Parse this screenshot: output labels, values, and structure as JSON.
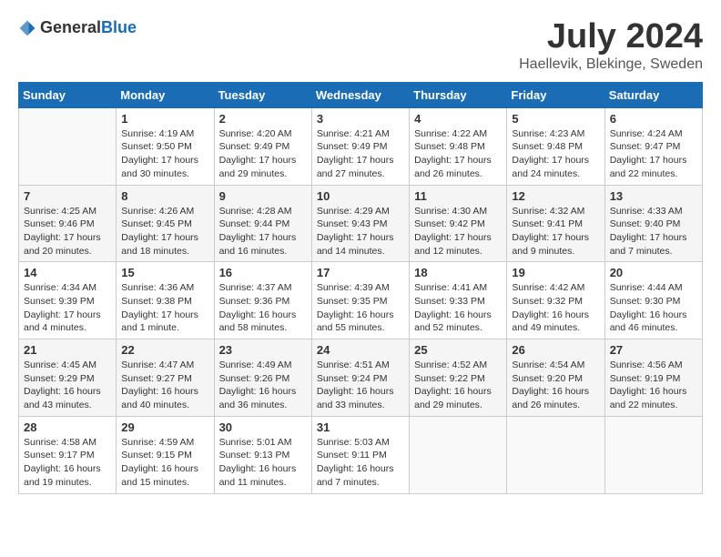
{
  "header": {
    "logo_general": "General",
    "logo_blue": "Blue",
    "title": "July 2024",
    "subtitle": "Haellevik, Blekinge, Sweden"
  },
  "calendar": {
    "days_of_week": [
      "Sunday",
      "Monday",
      "Tuesday",
      "Wednesday",
      "Thursday",
      "Friday",
      "Saturday"
    ],
    "weeks": [
      [
        {
          "day": "",
          "info": ""
        },
        {
          "day": "1",
          "info": "Sunrise: 4:19 AM\nSunset: 9:50 PM\nDaylight: 17 hours\nand 30 minutes."
        },
        {
          "day": "2",
          "info": "Sunrise: 4:20 AM\nSunset: 9:49 PM\nDaylight: 17 hours\nand 29 minutes."
        },
        {
          "day": "3",
          "info": "Sunrise: 4:21 AM\nSunset: 9:49 PM\nDaylight: 17 hours\nand 27 minutes."
        },
        {
          "day": "4",
          "info": "Sunrise: 4:22 AM\nSunset: 9:48 PM\nDaylight: 17 hours\nand 26 minutes."
        },
        {
          "day": "5",
          "info": "Sunrise: 4:23 AM\nSunset: 9:48 PM\nDaylight: 17 hours\nand 24 minutes."
        },
        {
          "day": "6",
          "info": "Sunrise: 4:24 AM\nSunset: 9:47 PM\nDaylight: 17 hours\nand 22 minutes."
        }
      ],
      [
        {
          "day": "7",
          "info": "Sunrise: 4:25 AM\nSunset: 9:46 PM\nDaylight: 17 hours\nand 20 minutes."
        },
        {
          "day": "8",
          "info": "Sunrise: 4:26 AM\nSunset: 9:45 PM\nDaylight: 17 hours\nand 18 minutes."
        },
        {
          "day": "9",
          "info": "Sunrise: 4:28 AM\nSunset: 9:44 PM\nDaylight: 17 hours\nand 16 minutes."
        },
        {
          "day": "10",
          "info": "Sunrise: 4:29 AM\nSunset: 9:43 PM\nDaylight: 17 hours\nand 14 minutes."
        },
        {
          "day": "11",
          "info": "Sunrise: 4:30 AM\nSunset: 9:42 PM\nDaylight: 17 hours\nand 12 minutes."
        },
        {
          "day": "12",
          "info": "Sunrise: 4:32 AM\nSunset: 9:41 PM\nDaylight: 17 hours\nand 9 minutes."
        },
        {
          "day": "13",
          "info": "Sunrise: 4:33 AM\nSunset: 9:40 PM\nDaylight: 17 hours\nand 7 minutes."
        }
      ],
      [
        {
          "day": "14",
          "info": "Sunrise: 4:34 AM\nSunset: 9:39 PM\nDaylight: 17 hours\nand 4 minutes."
        },
        {
          "day": "15",
          "info": "Sunrise: 4:36 AM\nSunset: 9:38 PM\nDaylight: 17 hours\nand 1 minute."
        },
        {
          "day": "16",
          "info": "Sunrise: 4:37 AM\nSunset: 9:36 PM\nDaylight: 16 hours\nand 58 minutes."
        },
        {
          "day": "17",
          "info": "Sunrise: 4:39 AM\nSunset: 9:35 PM\nDaylight: 16 hours\nand 55 minutes."
        },
        {
          "day": "18",
          "info": "Sunrise: 4:41 AM\nSunset: 9:33 PM\nDaylight: 16 hours\nand 52 minutes."
        },
        {
          "day": "19",
          "info": "Sunrise: 4:42 AM\nSunset: 9:32 PM\nDaylight: 16 hours\nand 49 minutes."
        },
        {
          "day": "20",
          "info": "Sunrise: 4:44 AM\nSunset: 9:30 PM\nDaylight: 16 hours\nand 46 minutes."
        }
      ],
      [
        {
          "day": "21",
          "info": "Sunrise: 4:45 AM\nSunset: 9:29 PM\nDaylight: 16 hours\nand 43 minutes."
        },
        {
          "day": "22",
          "info": "Sunrise: 4:47 AM\nSunset: 9:27 PM\nDaylight: 16 hours\nand 40 minutes."
        },
        {
          "day": "23",
          "info": "Sunrise: 4:49 AM\nSunset: 9:26 PM\nDaylight: 16 hours\nand 36 minutes."
        },
        {
          "day": "24",
          "info": "Sunrise: 4:51 AM\nSunset: 9:24 PM\nDaylight: 16 hours\nand 33 minutes."
        },
        {
          "day": "25",
          "info": "Sunrise: 4:52 AM\nSunset: 9:22 PM\nDaylight: 16 hours\nand 29 minutes."
        },
        {
          "day": "26",
          "info": "Sunrise: 4:54 AM\nSunset: 9:20 PM\nDaylight: 16 hours\nand 26 minutes."
        },
        {
          "day": "27",
          "info": "Sunrise: 4:56 AM\nSunset: 9:19 PM\nDaylight: 16 hours\nand 22 minutes."
        }
      ],
      [
        {
          "day": "28",
          "info": "Sunrise: 4:58 AM\nSunset: 9:17 PM\nDaylight: 16 hours\nand 19 minutes."
        },
        {
          "day": "29",
          "info": "Sunrise: 4:59 AM\nSunset: 9:15 PM\nDaylight: 16 hours\nand 15 minutes."
        },
        {
          "day": "30",
          "info": "Sunrise: 5:01 AM\nSunset: 9:13 PM\nDaylight: 16 hours\nand 11 minutes."
        },
        {
          "day": "31",
          "info": "Sunrise: 5:03 AM\nSunset: 9:11 PM\nDaylight: 16 hours\nand 7 minutes."
        },
        {
          "day": "",
          "info": ""
        },
        {
          "day": "",
          "info": ""
        },
        {
          "day": "",
          "info": ""
        }
      ]
    ]
  }
}
